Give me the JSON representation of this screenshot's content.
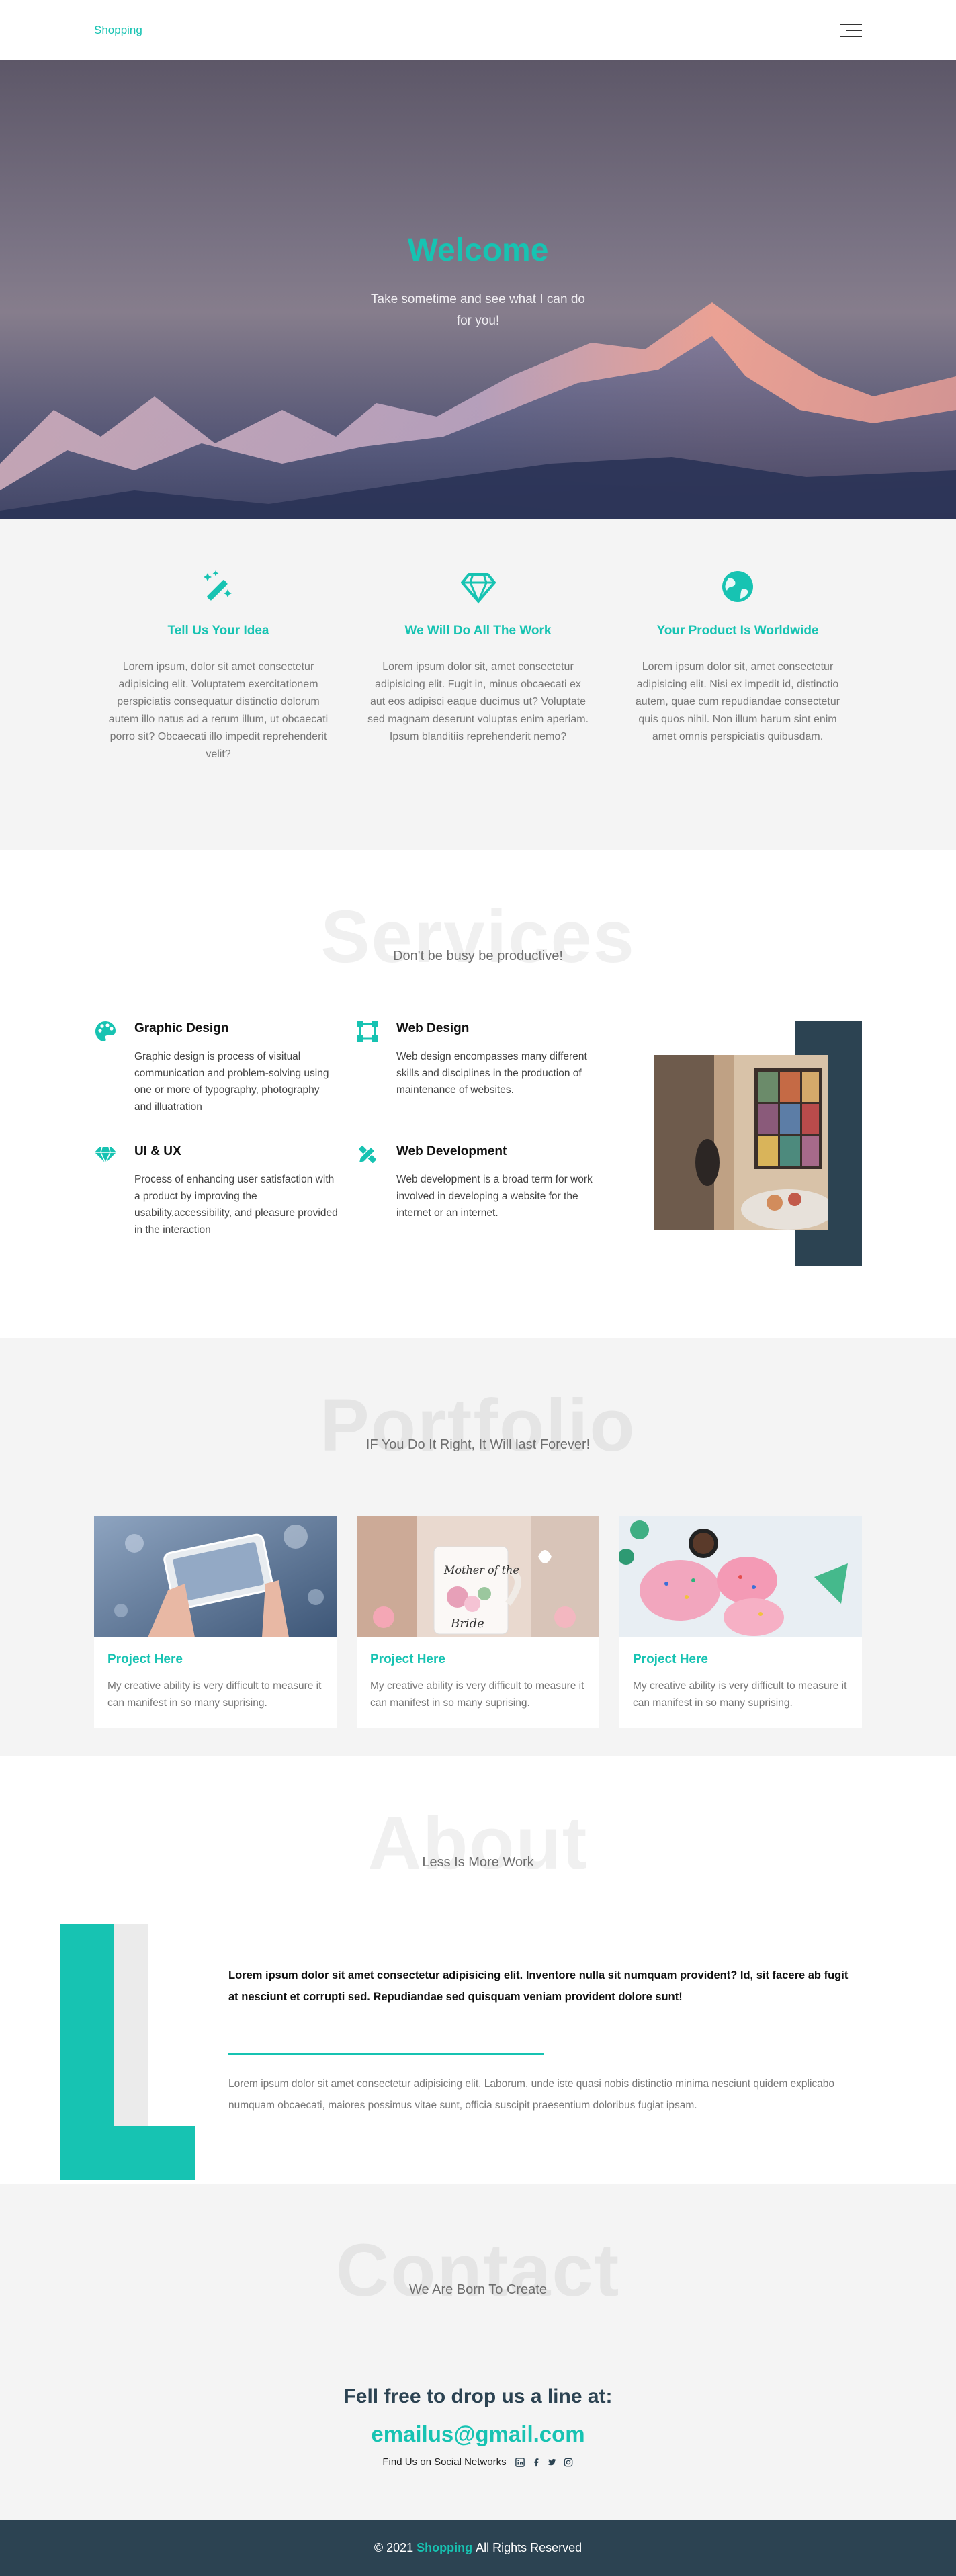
{
  "colors": {
    "accent": "#17c3b2",
    "dark": "#2c4352",
    "light_bg": "#f4f4f4"
  },
  "nav": {
    "brand": "Shopping",
    "menu_icon": "hamburger-icon"
  },
  "hero": {
    "title": "Welcome",
    "subtitle": "Take sometime and see what I can do for you!"
  },
  "features": [
    {
      "icon": "magic-wand-icon",
      "title": "Tell Us Your Idea",
      "text": "Lorem ipsum, dolor sit amet consectetur adipisicing elit. Voluptatem exercitationem perspiciatis consequatur distinctio dolorum autem illo natus ad a rerum illum, ut obcaecati porro sit? Obcaecati illo impedit reprehenderit velit?"
    },
    {
      "icon": "diamond-icon",
      "title": "We Will Do All The Work",
      "text": "Lorem ipsum dolor sit, amet consectetur adipisicing elit. Fugit in, minus obcaecati ex aut eos adipisci eaque ducimus ut? Voluptate sed magnam deserunt voluptas enim aperiam. Ipsum blanditiis reprehenderit nemo?"
    },
    {
      "icon": "globe-icon",
      "title": "Your Product Is Worldwide",
      "text": "Lorem ipsum dolor sit, amet consectetur adipisicing elit. Nisi ex impedit id, distinctio autem, quae cum repudiandae consectetur quis quos nihil. Non illum harum sint enim amet omnis perspiciatis quibusdam."
    }
  ],
  "services": {
    "bg_title": "Services",
    "subtitle": "Don't be busy be productive!",
    "items": [
      {
        "icon": "palette-icon",
        "title": "Graphic Design",
        "text": "Graphic design is process of visitual communication and problem-solving using one or more of typography, photography and illuatration"
      },
      {
        "icon": "vector-square-icon",
        "title": "Web Design",
        "text": "Web design encompasses many different skills and disciplines in the production of maintenance of websites."
      },
      {
        "icon": "gem-icon",
        "title": "UI & UX",
        "text": "Process of enhancing user satisfaction with a product by improving the usability,accessibility, and pleasure provided in the interaction"
      },
      {
        "icon": "pencil-ruler-icon",
        "title": "Web Development",
        "text": "Web development is a broad term for work involved in developing a website for the internet or an internet."
      }
    ]
  },
  "portfolio": {
    "bg_title": "Portfolio",
    "subtitle": "IF You Do It Right, It Will last Forever!",
    "cards": [
      {
        "title": "Project Here",
        "text": "My creative ability is very difficult to measure it can manifest in so many suprising."
      },
      {
        "title": "Project Here",
        "text": "My creative ability is very difficult to measure it can manifest in so many suprising."
      },
      {
        "title": "Project Here",
        "text": "My creative ability is very difficult to measure it can manifest in so many suprising."
      }
    ]
  },
  "about": {
    "bg_title": "About",
    "subtitle": "Less Is More Work",
    "lead": "Lorem ipsum dolor sit amet consectetur adipisicing elit. Inventore nulla sit numquam provident? Id, sit facere ab fugit at nesciunt et corrupti sed. Repudiandae sed quisquam veniam provident dolore sunt!",
    "body": "Lorem ipsum dolor sit amet consectetur adipisicing elit. Laborum, unde iste quasi nobis distinctio minima nesciunt quidem explicabo numquam obcaecati, maiores possimus vitae sunt, officia suscipit praesentium doloribus fugiat ipsam."
  },
  "contact": {
    "bg_title": "Contact",
    "subtitle": "We Are Born To Create",
    "headline": "Fell free to drop us a line at:",
    "email": "emailus@gmail.com",
    "social_label": "Find Us on Social Networks",
    "social_icons": [
      "linkedin-icon",
      "facebook-icon",
      "twitter-icon",
      "instagram-icon"
    ]
  },
  "footer": {
    "prefix": "© 2021",
    "brand": "Shopping",
    "suffix": "All Rights Reserved"
  }
}
